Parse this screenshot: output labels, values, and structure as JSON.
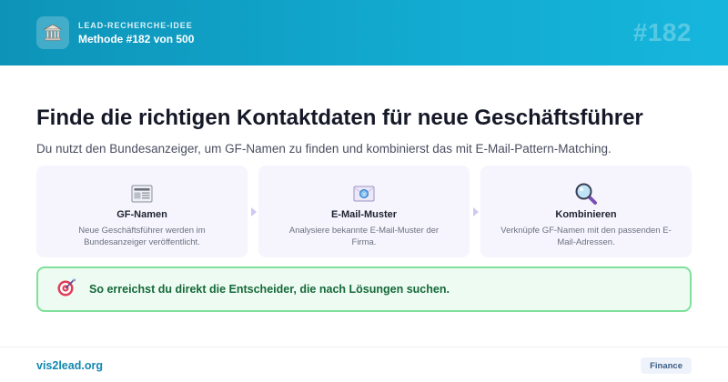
{
  "header": {
    "kicker": "LEAD-RECHERCHE-IDEE",
    "method": "Methode #182 von 500",
    "number": "#182",
    "icon": "bank-building-icon"
  },
  "main": {
    "title": "Finde die richtigen Kontaktdaten für neue Geschäftsführer",
    "subtitle": "Du nutzt den Bundesanzeiger, um GF-Namen zu finden und kombinierst das mit E-Mail-Pattern-Matching."
  },
  "steps": [
    {
      "icon": "newspaper-icon",
      "title": "GF-Namen",
      "desc": "Neue Geschäftsführer werden im Bundesanzeiger veröffentlicht."
    },
    {
      "icon": "email-envelope-icon",
      "title": "E-Mail-Muster",
      "desc": "Analysiere bekannte E-Mail-Muster der Firma."
    },
    {
      "icon": "magnifying-glass-icon",
      "title": "Kombinieren",
      "desc": "Verknüpfe GF-Namen mit den passenden E-Mail-Adressen."
    }
  ],
  "callout": {
    "icon": "target-dart-icon",
    "text": "So erreichst du direkt die Entscheider, die nach Lösungen suchen."
  },
  "footer": {
    "domain": "vis2lead.org",
    "badge": "Finance"
  },
  "colors": {
    "header_gradient_start": "#0e93b8",
    "header_gradient_end": "#16b6dc",
    "card_background": "#f6f5fd",
    "callout_border": "#7fe09b",
    "callout_text": "#15693a",
    "footer_domain": "#1088b1"
  }
}
